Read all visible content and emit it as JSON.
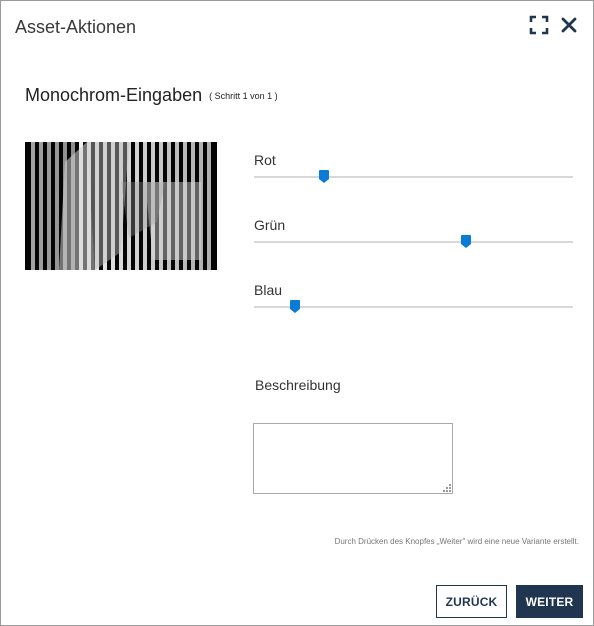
{
  "dialog": {
    "title": "Asset-Aktionen"
  },
  "header_icons": [
    "fullscreen-icon",
    "close-icon"
  ],
  "section": {
    "title": "Monochrom-Eingaben",
    "step": "( Schritt 1 von 1 )"
  },
  "sliders": [
    {
      "label": "Rot",
      "value": 0.22
    },
    {
      "label": "Grün",
      "value": 0.665
    },
    {
      "label": "Blau",
      "value": 0.13
    }
  ],
  "description": {
    "label": "Beschreibung",
    "value": ""
  },
  "hint": "Durch Drücken des Knopfes „Weiter\" wird eine neue Variante erstellt.",
  "buttons": {
    "back": "ZURÜCK",
    "next": "WEITER"
  },
  "colors": {
    "accent": "#0a7bd7",
    "primary_button": "#1f3550",
    "track": "#d8d8d8"
  }
}
